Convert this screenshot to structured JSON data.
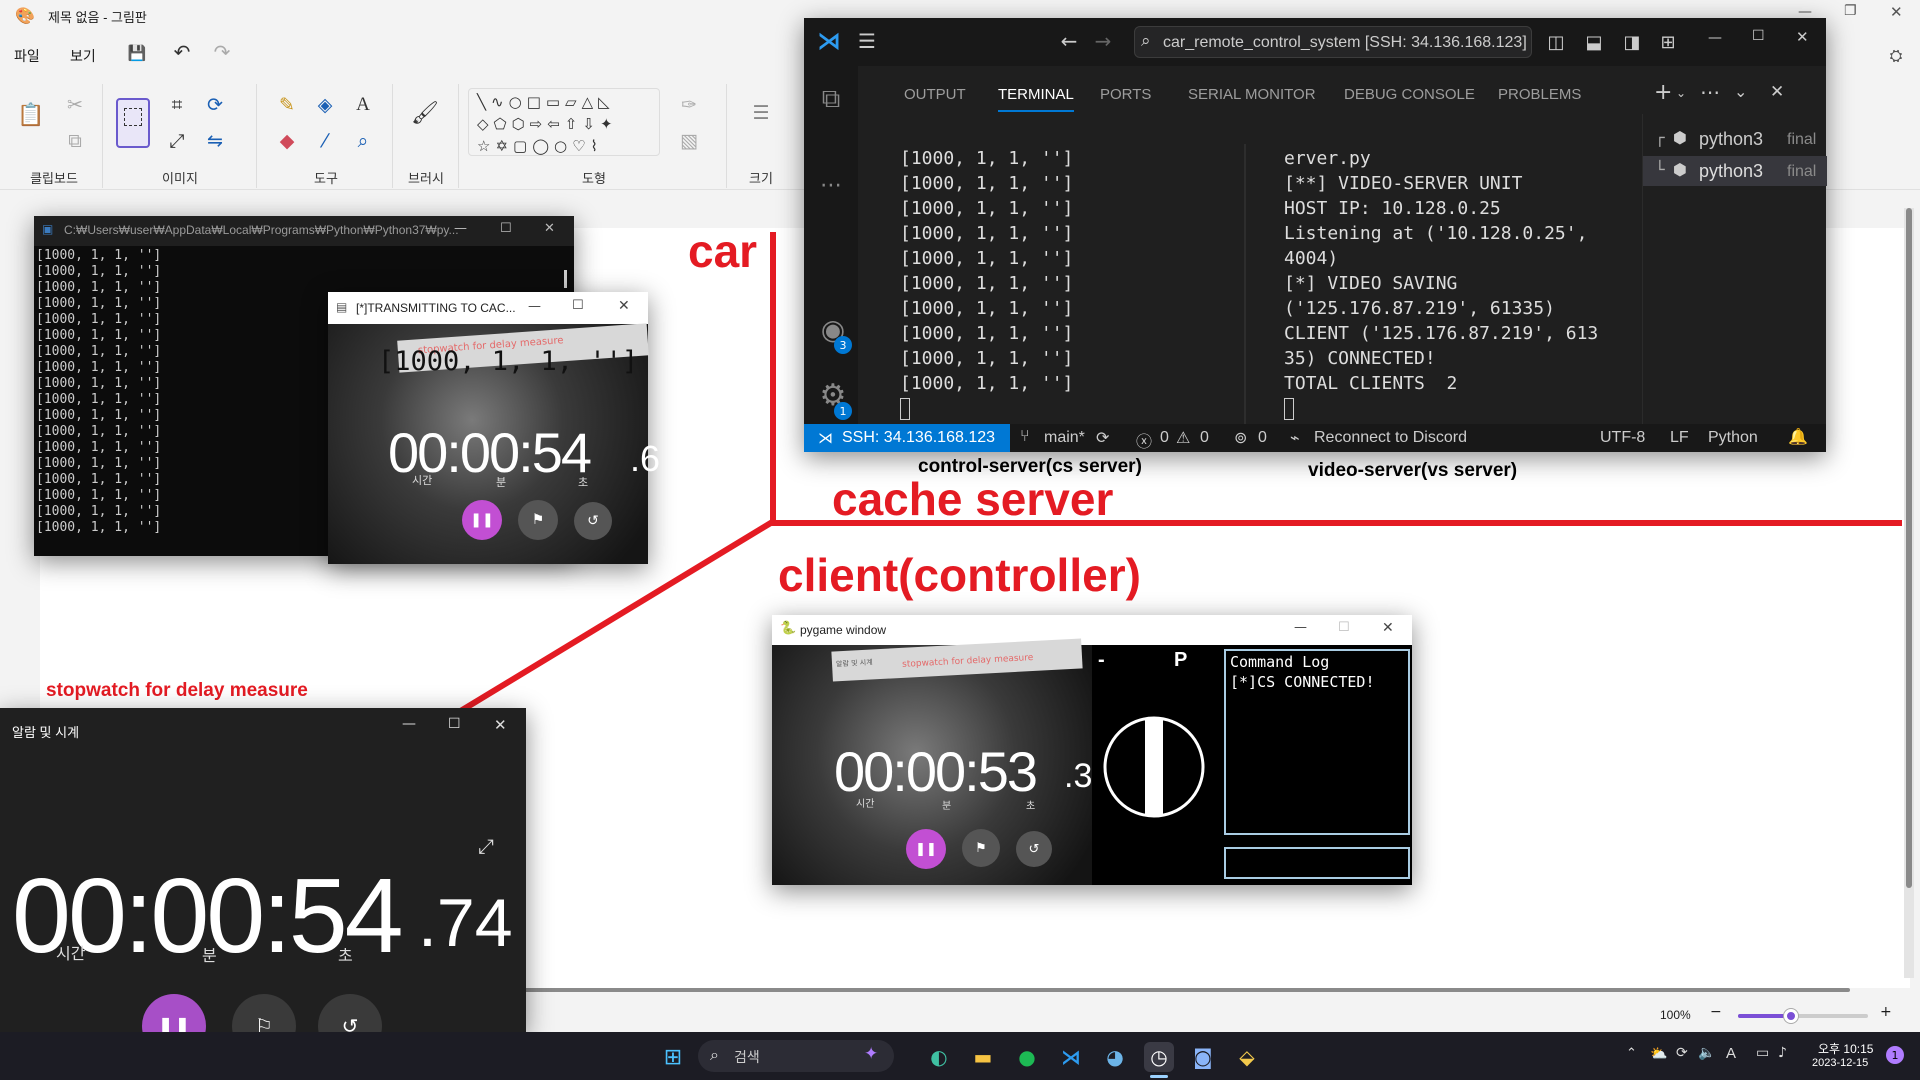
{
  "paint": {
    "title": "제목 없음 - 그림판",
    "menu": {
      "file": "파일",
      "view": "보기"
    },
    "ribbon": {
      "clipboard": "클립보드",
      "image": "이미지",
      "tools": "도구",
      "brushes": "브러시",
      "shapes": "도형",
      "size": "크기"
    },
    "zoom": "100%"
  },
  "console": {
    "title": "C:₩Users₩user₩AppData₩Local₩Programs₩Python₩Python37₩py...",
    "lines": [
      "[1000, 1, 1, '']",
      "[1000, 1, 1, '']",
      "[1000, 1, 1, '']",
      "[1000, 1, 1, '']",
      "[1000, 1, 1, '']",
      "[1000, 1, 1, '']",
      "[1000, 1, 1, '']",
      "[1000, 1, 1, '']",
      "[1000, 1, 1, '']",
      "[1000, 1, 1, '']",
      "[1000, 1, 1, '']",
      "[1000, 1, 1, '']",
      "[1000, 1, 1, '']",
      "[1000, 1, 1, '']",
      "[1000, 1, 1, '']",
      "[1000, 1, 1, '']",
      "[1000, 1, 1, '']",
      "[1000, 1, 1, '']"
    ]
  },
  "transmit": {
    "title": "[*]TRANSMITTING TO CAC...",
    "overlay": "[1000, 1, 1, '']",
    "sticky": "stopwatch for delay measure",
    "time_main": "00:00:54",
    "time_frac": ".6",
    "lbl_h": "시간",
    "lbl_m": "분",
    "lbl_s": "초"
  },
  "vscode": {
    "search": "car_remote_control_system [SSH: 34.136.168.123]",
    "tabs": [
      "OUTPUT",
      "TERMINAL",
      "PORTS",
      "SERIAL MONITOR",
      "DEBUG CONSOLE",
      "PROBLEMS"
    ],
    "terminals": [
      {
        "name": "python3",
        "tag": "final"
      },
      {
        "name": "python3",
        "tag": "final"
      }
    ],
    "left_lines": [
      "[1000, 1, 1, '']",
      "[1000, 1, 1, '']",
      "[1000, 1, 1, '']",
      "[1000, 1, 1, '']",
      "[1000, 1, 1, '']",
      "[1000, 1, 1, '']",
      "[1000, 1, 1, '']",
      "[1000, 1, 1, '']",
      "[1000, 1, 1, '']",
      "[1000, 1, 1, '']"
    ],
    "right_lines": [
      "erver.py",
      "[**] VIDEO-SERVER UNIT",
      "HOST IP: 10.128.0.25",
      "Listening at ('10.128.0.25',",
      "4004)",
      "[*] VIDEO SAVING",
      "('125.176.87.219', 61335)",
      "CLIENT ('125.176.87.219', 613",
      "35) CONNECTED!",
      "TOTAL CLIENTS  2"
    ],
    "badge_accounts": "3",
    "badge_settings": "1",
    "status": {
      "remote": "SSH: 34.136.168.123",
      "branch": "main*",
      "errors": "0",
      "warnings": "0",
      "ports": "0",
      "discord": "Reconnect to Discord",
      "encoding": "UTF-8",
      "eol": "LF",
      "language": "Python"
    }
  },
  "annotations": {
    "car": "car",
    "cache_server": "cache server",
    "client": "client(controller)",
    "control_server": "control-server(cs server)",
    "video_server": "video-server(vs server)",
    "stopwatch": "stopwatch for delay measure",
    "color": "#e41b23"
  },
  "pygame": {
    "title": "pygame window",
    "time_main": "00:00:53",
    "time_frac": ".3",
    "lbl_h": "시간",
    "lbl_m": "분",
    "lbl_s": "초",
    "sticky": "stopwatch for delay measure",
    "sticky_small": "알람 및 시계",
    "minus": "-",
    "gear": "P",
    "log_title": "Command Log",
    "log_line": "[*]CS CONNECTED!"
  },
  "alarm": {
    "title": "알람 및 시계",
    "time_main": "00:00:54",
    "time_frac": ".74",
    "lbl_h": "시간",
    "lbl_m": "분",
    "lbl_s": "초"
  },
  "taskbar": {
    "search": "검색",
    "time": "오후 10:15",
    "date": "2023-12-15",
    "notification_count": "1",
    "ime": "A"
  }
}
